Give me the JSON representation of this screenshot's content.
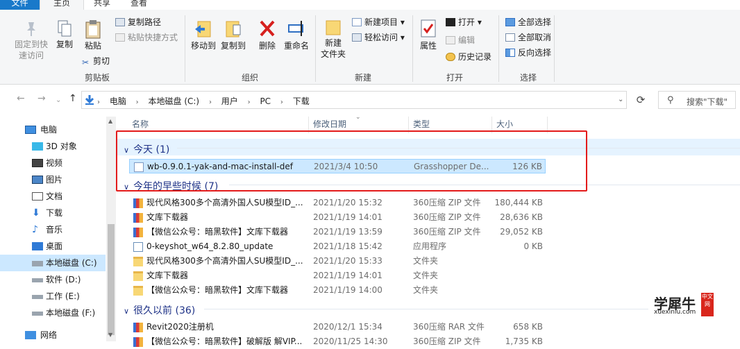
{
  "tabs": {
    "file": "文件",
    "home": "主页",
    "share": "共享",
    "view": "查看"
  },
  "ribbon": {
    "pin": "固定到快\n速访问",
    "copy": "复制",
    "paste": "粘贴",
    "copy_path": "复制路径",
    "paste_shortcut": "粘贴快捷方式",
    "cut": "剪切",
    "clipboard_group": "剪贴板",
    "move_to": "移动到",
    "copy_to": "复制到",
    "delete": "删除",
    "rename": "重命名",
    "organize_group": "组织",
    "new_folder": "新建\n文件夹",
    "new_item": "新建项目",
    "easy_access": "轻松访问",
    "new_group": "新建",
    "properties": "属性",
    "open": "打开",
    "edit": "编辑",
    "history": "历史记录",
    "open_group": "打开",
    "select_all": "全部选择",
    "select_none": "全部取消",
    "invert_selection": "反向选择",
    "select_group": "选择"
  },
  "address": {
    "crumbs": [
      "电脑",
      "本地磁盘 (C:)",
      "用户",
      "PC",
      "下载"
    ],
    "search_placeholder": "搜索\"下载\""
  },
  "sidebar": {
    "items": [
      {
        "label": "电脑",
        "icon": "computer-icon"
      },
      {
        "label": "3D 对象",
        "icon": "cube-icon"
      },
      {
        "label": "视频",
        "icon": "video-icon"
      },
      {
        "label": "图片",
        "icon": "picture-icon"
      },
      {
        "label": "文档",
        "icon": "document-icon"
      },
      {
        "label": "下载",
        "icon": "download-icon"
      },
      {
        "label": "音乐",
        "icon": "music-icon"
      },
      {
        "label": "桌面",
        "icon": "desktop-icon"
      },
      {
        "label": "本地磁盘 (C:)",
        "icon": "drive-icon"
      },
      {
        "label": "软件 (D:)",
        "icon": "drive-icon"
      },
      {
        "label": "工作 (E:)",
        "icon": "drive-icon"
      },
      {
        "label": "本地磁盘 (F:)",
        "icon": "drive-icon"
      },
      {
        "label": "网络",
        "icon": "network-icon"
      }
    ]
  },
  "columns": {
    "name": "名称",
    "date": "修改日期",
    "type": "类型",
    "size": "大小"
  },
  "groups": {
    "today": "今天 (1)",
    "earlier_this_year": "今年的早些时候 (7)",
    "long_ago": "很久以前 (36)"
  },
  "rows_today": [
    {
      "name": "wb-0.9.0.1-yak-and-mac-install-def",
      "date": "2021/3/4 10:50",
      "type": "Grasshopper De...",
      "size": "126 KB",
      "icon": "file-icon"
    }
  ],
  "rows_year": [
    {
      "name": "现代风格300多个高清外国人SU模型ID_...",
      "date": "2021/1/20 15:32",
      "type": "360压缩 ZIP 文件",
      "size": "180,444 KB",
      "icon": "zip-icon"
    },
    {
      "name": "文库下载器",
      "date": "2021/1/19 14:01",
      "type": "360压缩 ZIP 文件",
      "size": "28,636 KB",
      "icon": "zip-icon"
    },
    {
      "name": "【微信公众号：暗黑软件】文库下载器",
      "date": "2021/1/19 13:59",
      "type": "360压缩 ZIP 文件",
      "size": "29,052 KB",
      "icon": "zip-icon"
    },
    {
      "name": "0-keyshot_w64_8.2.80_update",
      "date": "2021/1/18 15:42",
      "type": "应用程序",
      "size": "0 KB",
      "icon": "exe-icon"
    },
    {
      "name": "现代风格300多个高清外国人SU模型ID_...",
      "date": "2021/1/20 15:33",
      "type": "文件夹",
      "size": "",
      "icon": "folder-icon"
    },
    {
      "name": "文库下载器",
      "date": "2021/1/19 14:01",
      "type": "文件夹",
      "size": "",
      "icon": "folder-icon"
    },
    {
      "name": "【微信公众号：暗黑软件】文库下载器",
      "date": "2021/1/19 14:00",
      "type": "文件夹",
      "size": "",
      "icon": "folder-icon"
    }
  ],
  "rows_long": [
    {
      "name": "Revit2020注册机",
      "date": "2020/12/1 15:34",
      "type": "360压缩 RAR 文件",
      "size": "658 KB",
      "icon": "zip-icon"
    },
    {
      "name": "【微信公众号：暗黑软件】破解版 解VIP...",
      "date": "2020/11/25 14:30",
      "type": "360压缩 ZIP 文件",
      "size": "1,735 KB",
      "icon": "zip-icon"
    }
  ],
  "watermark": {
    "title": "学犀牛",
    "url": "xuexiniu.com",
    "badge": "中文网"
  },
  "colors": {
    "accent": "#1979ca",
    "selection": "#cce8ff",
    "highlight_box": "#e31a1a",
    "group_text": "#1e3287"
  }
}
